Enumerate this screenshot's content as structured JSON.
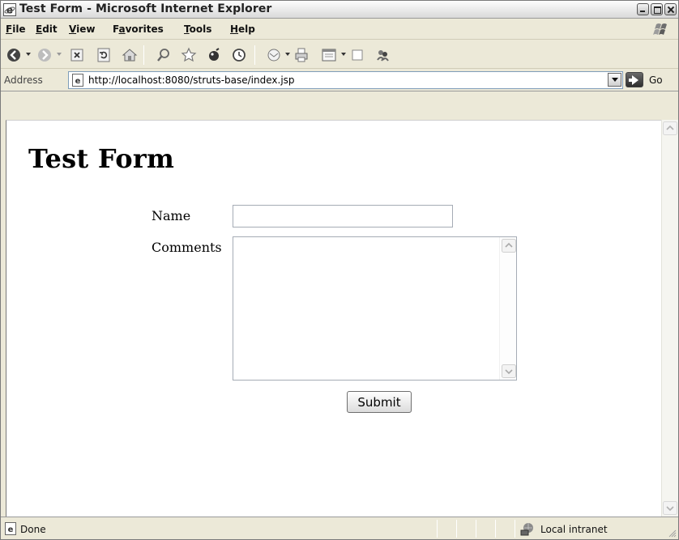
{
  "window": {
    "title": "Test Form - Microsoft Internet Explorer",
    "app_icon": "ie-icon",
    "buttons": [
      "minimize-icon",
      "maximize-icon",
      "close-icon"
    ]
  },
  "menubar": {
    "items": [
      {
        "label": "File",
        "accel": "F"
      },
      {
        "label": "Edit",
        "accel": "E"
      },
      {
        "label": "View",
        "accel": "V"
      },
      {
        "label": "Favorites",
        "accel": "a"
      },
      {
        "label": "Tools",
        "accel": "T"
      },
      {
        "label": "Help",
        "accel": "H"
      }
    ]
  },
  "toolbar": {
    "buttons": [
      "back-icon",
      "forward-icon",
      "stop-icon",
      "refresh-icon",
      "home-icon",
      "search-icon",
      "favorites-icon",
      "media-icon",
      "history-icon",
      "mail-icon",
      "print-icon",
      "edit-icon",
      "discuss-icon",
      "messenger-icon"
    ]
  },
  "address": {
    "label": "Address",
    "url": "http://localhost:8080/struts-base/index.jsp",
    "go_label": "Go"
  },
  "page": {
    "title": "Test Form",
    "name_label": "Name",
    "name_value": "",
    "comments_label": "Comments",
    "comments_value": "",
    "submit_label": "Submit"
  },
  "statusbar": {
    "status": "Done",
    "zone": "Local intranet"
  },
  "colors": {
    "chrome": "#ece9d8",
    "content": "#ffffff",
    "input_border": "#a5acb5"
  }
}
